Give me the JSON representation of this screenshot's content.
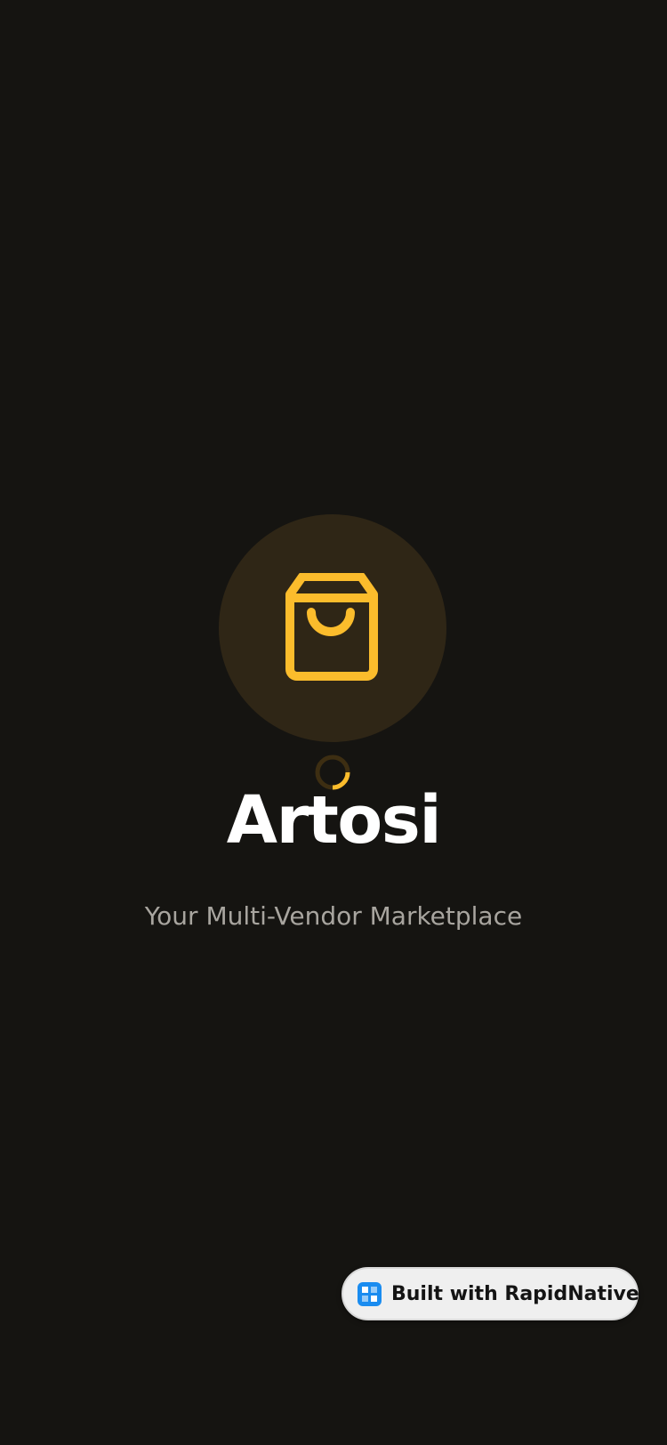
{
  "app": {
    "title": "Artosi",
    "tagline": "Your Multi-Vendor Marketplace",
    "logo_icon": "shopping-bag-icon",
    "loading_indicator": "spinner-icon"
  },
  "badge": {
    "label": "Built with RapidNative",
    "icon": "rapidnative-logo-icon"
  },
  "colors": {
    "background": "#151411",
    "accent": "#fbbc2c",
    "logo_circle": "#2f2616",
    "title": "#ffffff",
    "tagline": "#a8a59f",
    "badge_background": "#efefef",
    "badge_icon": "#1a8cf0"
  }
}
